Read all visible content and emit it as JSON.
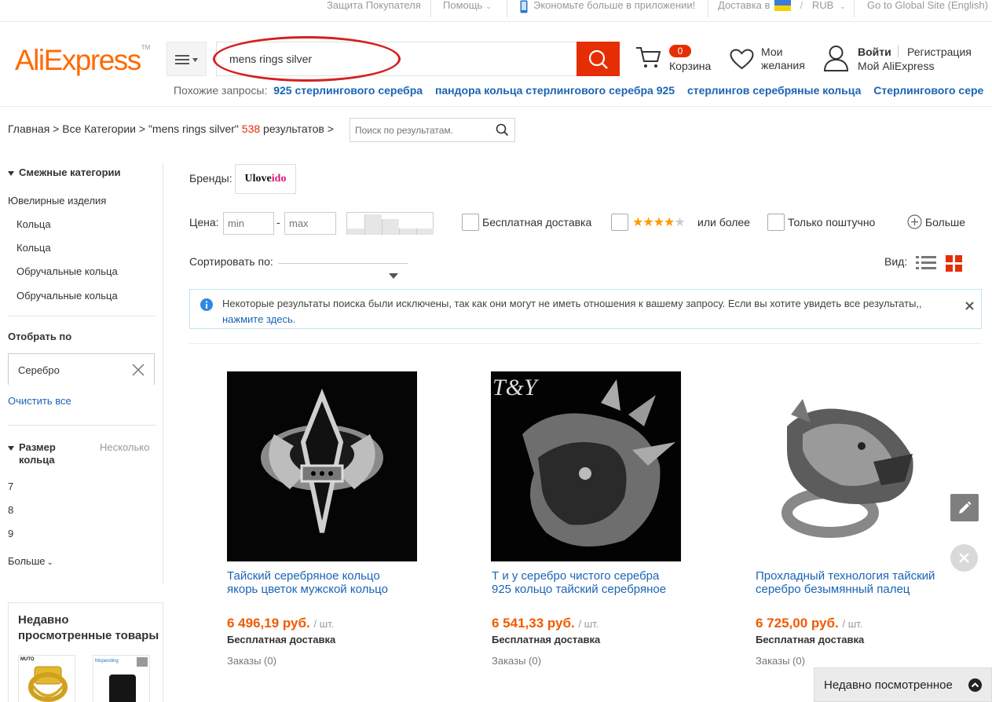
{
  "topbar": {
    "buyer_protection": "Защита Покупателя",
    "help": "Помощь",
    "app_promo": "Экономьте больше в приложении!",
    "ship_to": "Доставка в",
    "currency": "RUB",
    "global_site": "Go to Global Site (English)"
  },
  "header": {
    "logo": "AliExpress",
    "logo_tm": "TM",
    "search_value": "mens rings silver",
    "cart_count": "0",
    "cart_label": "Корзина",
    "wishlist_line1": "Мои",
    "wishlist_line2": "желания",
    "signin": "Войти",
    "register": "Регистрация",
    "my_account": "Мой AliExpress",
    "accent_color": "#e62e04"
  },
  "related": {
    "label": "Похожие запросы:",
    "items": [
      "925 стерлингового серебра",
      "пандора кольца стерлингового серебра 925",
      "стерлингов серебряные кольца",
      "Стерлингового сере"
    ]
  },
  "breadcrumb": {
    "home": "Главная",
    "all_categories": "Все Категории",
    "query": "\"mens rings silver\"",
    "count": "538",
    "results": "результатов",
    "search_placeholder": "Поиск по результатам."
  },
  "sidebar": {
    "related_title": "Смежные категории",
    "category_root": "Ювелирные изделия",
    "categories": [
      "Кольца",
      "Кольца",
      "Обручальные кольца",
      "Обручальные кольца"
    ],
    "filter_title": "Отобрать по",
    "active_filter": "Серебро",
    "clear_all": "Очистить все",
    "ring_size_line1": "Размер",
    "ring_size_line2": "кольца",
    "multi": "Несколько",
    "sizes": [
      "7",
      "8",
      "9"
    ],
    "more": "Больше",
    "recent_title_line1": "Недавно",
    "recent_title_line2": "просмотренные товары",
    "recent_thumb_1_text": "MUTO",
    "recent_thumb_2_text": "Mopending"
  },
  "filters": {
    "brands_label": "Бренды:",
    "brand_main": "Ulove",
    "brand_accent": "ido",
    "price_label": "Цена:",
    "min_placeholder": "min",
    "max_placeholder": "max",
    "dash": "-",
    "free_shipping": "Бесплатная доставка",
    "rating_stars": "★★★★",
    "rating_empty_star": "★",
    "rating_label": "или более",
    "single_piece": "Только поштучно",
    "more": "Больше",
    "sort_label": "Сортировать по:",
    "view_label": "Вид:"
  },
  "notice": {
    "text": "Некоторые результаты поиска были исключены, так как они могут не иметь отношения к вашему запросу. Если вы хотите увидеть все результаты,,",
    "link": "нажмите здесь."
  },
  "products": [
    {
      "title_line1": "Тайский серебряное кольцо",
      "title_line2": "якорь цветок мужской кольцо",
      "price": "6 496,19 руб.",
      "unit": "/ шт.",
      "shipping": "Бесплатная доставка",
      "orders": "Заказы (0)"
    },
    {
      "title_line1": "Т и у серебро чистого серебра",
      "title_line2": "925 кольцо тайский серебряное",
      "price": "6 541,33 руб.",
      "unit": "/ шт.",
      "shipping": "Бесплатная доставка",
      "orders": "Заказы (0)",
      "image_overlay": "T&Y"
    },
    {
      "title_line1": "Прохладный технология тайский",
      "title_line2": "серебро безымянный палец",
      "price": "6 725,00 руб.",
      "unit": "/ шт.",
      "shipping": "Бесплатная доставка",
      "orders": "Заказы (0)"
    }
  ],
  "recent_bar": {
    "label": "Недавно посмотренное"
  }
}
